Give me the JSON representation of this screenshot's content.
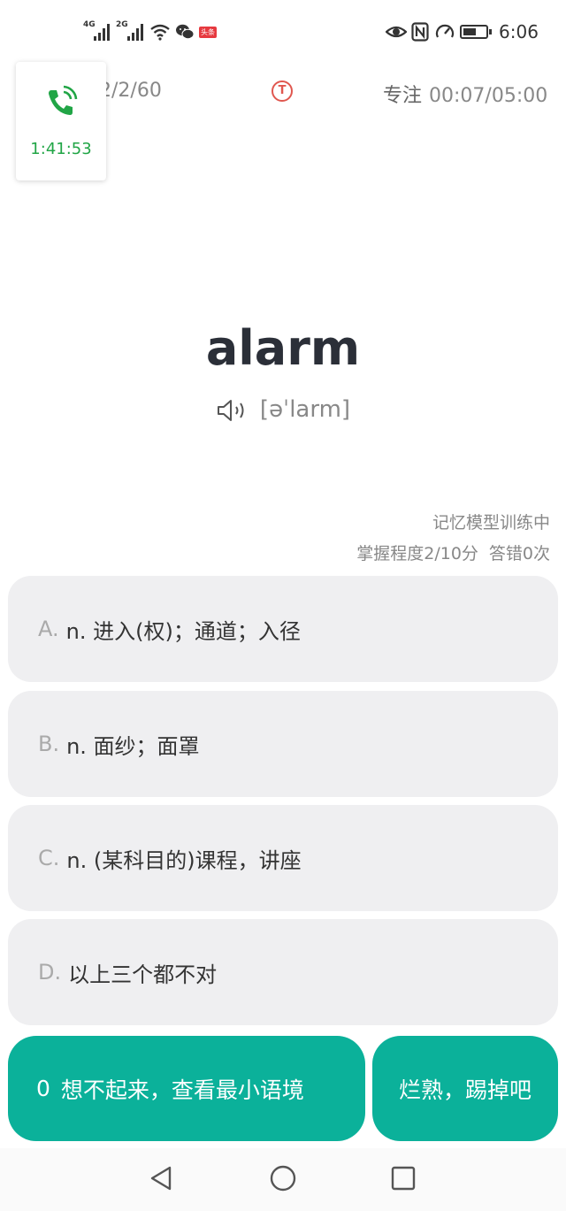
{
  "status_bar": {
    "net1": "4G",
    "net2": "2G",
    "toutiao_badge": "头条",
    "time": "6:06"
  },
  "call": {
    "duration": "1:41:53"
  },
  "header": {
    "progress": "2/2/60",
    "tips_icon": "T",
    "focus_label": "专注",
    "focus_time": "00:07/05:00"
  },
  "word": {
    "text": "alarm",
    "phonetic": "[əˈlarm]"
  },
  "training": {
    "model_status": "记忆模型训练中",
    "mastery": "掌握程度2/10分",
    "errors": "答错0次"
  },
  "options": [
    {
      "letter": "A.",
      "text": "n. 进入(权)；通道；入径"
    },
    {
      "letter": "B.",
      "text": "n. 面纱；面罩"
    },
    {
      "letter": "C.",
      "text": "n. (某科目的)课程，讲座"
    },
    {
      "letter": "D.",
      "text": "以上三个都不对"
    }
  ],
  "buttons": {
    "forgot_count": "0",
    "forgot_label": "想不起来，查看最小语境",
    "known_label": "烂熟，踢掉吧"
  },
  "colors": {
    "accent": "#0bb19a",
    "call_green": "#21a546",
    "tips_red": "#e0574f",
    "option_bg": "#efeff1"
  },
  "icons": {
    "call": "phone-call-icon",
    "speaker": "speaker-icon",
    "tips": "t-circle-icon",
    "nav_back": "triangle-back-icon",
    "nav_home": "circle-home-icon",
    "nav_recent": "square-recent-icon"
  }
}
